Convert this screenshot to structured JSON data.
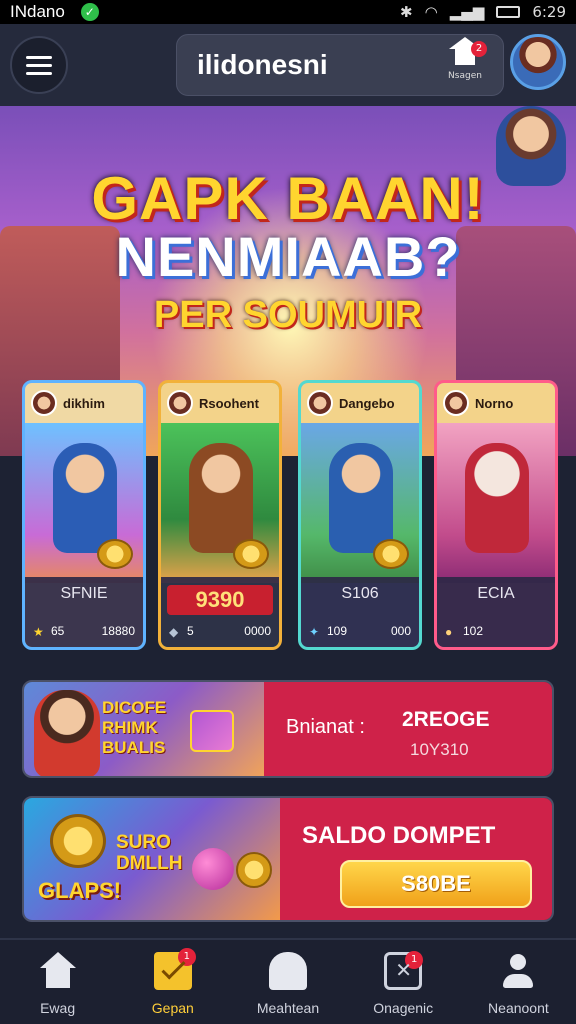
{
  "status_bar": {
    "carrier": "INdano",
    "time": "6:29"
  },
  "header": {
    "logo_text": "ilidonesni",
    "home_label": "Nsagen",
    "home_badge": "2"
  },
  "hero": {
    "line1": "GAPK BAAN!",
    "line2": "NENMIAAB?",
    "line3": "PER SOUMUIR"
  },
  "games": [
    {
      "name": "dikhim",
      "title": "SFNIE",
      "stat_left": "65",
      "stat_right": "18880"
    },
    {
      "name": "Rsoohent",
      "price": "9390",
      "stat_left": "5",
      "stat_right": "0000"
    },
    {
      "name": "Dangebo",
      "title": "S106",
      "stat_left": "109",
      "stat_right": "000"
    },
    {
      "name": "Norno",
      "title": "ECIA",
      "stat_left": "102",
      "stat_right": ""
    }
  ],
  "promo_banner": {
    "art_text": "DICOFE RHIMK BUALIS",
    "label": "Bnianat :",
    "value_main": "2REOGE",
    "value_sub": "10Y310"
  },
  "wallet_banner": {
    "art_text": "SURO DMLLH",
    "art_text2": "GLAPS!",
    "title": "SALDO DOMPET",
    "button_label": "S80BE"
  },
  "bottom_nav": [
    {
      "label": "Ewag",
      "badge": ""
    },
    {
      "label": "Gepan",
      "badge": "1",
      "active": true
    },
    {
      "label": "Meahtean",
      "badge": ""
    },
    {
      "label": "Onagenic",
      "badge": "1"
    },
    {
      "label": "Neanoont",
      "badge": ""
    }
  ]
}
